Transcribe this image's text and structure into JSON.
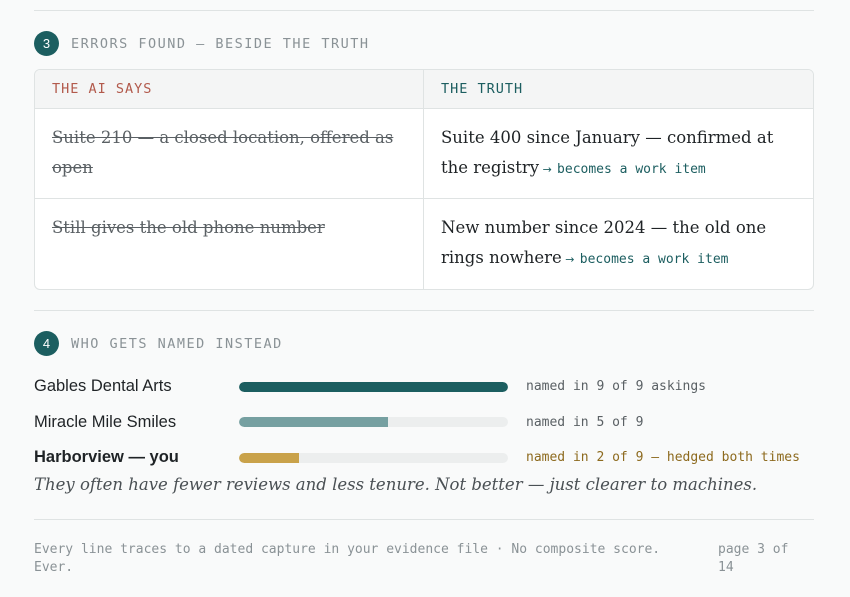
{
  "section3": {
    "number": "3",
    "title": "ERRORS FOUND — BESIDE THE TRUTH",
    "col_ai": "THE AI SAYS",
    "col_truth": "THE TRUTH",
    "rows": [
      {
        "ai": "Suite 210 — a closed location, offered as open",
        "truth": "Suite 400 since January — confirmed at the registry",
        "action": "becomes a work item"
      },
      {
        "ai": "Still gives the old phone number",
        "truth": "New number since 2024 — the old one rings nowhere",
        "action": "becomes a work item"
      }
    ]
  },
  "section4": {
    "number": "4",
    "title": "WHO GETS NAMED INSTEAD",
    "competitors": [
      {
        "name": "Gables Dental Arts",
        "count": 9,
        "total": 9,
        "note": "named in 9 of 9 askings",
        "color": "#1c5e60"
      },
      {
        "name": "Miracle Mile Smiles",
        "count": 5,
        "total": 9,
        "note": "named in 5 of 9",
        "color": "#76a0a1"
      },
      {
        "name": "Harborview — you",
        "count": 2,
        "total": 9,
        "note": "named in 2 of 9 — hedged both times",
        "color": "#c9a24a",
        "is_you": true
      }
    ],
    "quote": "They often have fewer reviews and less tenure. Not better — just clearer to machines."
  },
  "footer": {
    "note": "Every line traces to a dated capture in your evidence file · No composite score. Ever.",
    "page": "page 3 of 14"
  }
}
